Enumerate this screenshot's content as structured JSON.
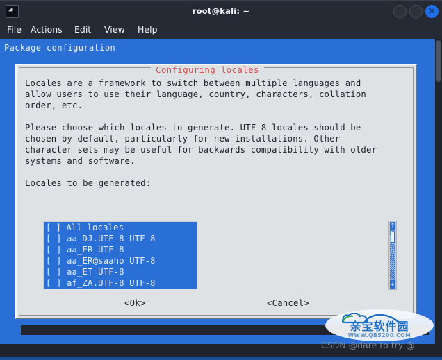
{
  "window": {
    "title": "root@kali: ~",
    "icon": "terminal-icon",
    "icon_glyph": "◢",
    "controls": {
      "minimize_label": "",
      "maximize_label": "",
      "close_label": "✕"
    }
  },
  "menubar": {
    "items": [
      {
        "label": "File"
      },
      {
        "label": "Actions"
      },
      {
        "label": "Edit"
      },
      {
        "label": "View"
      },
      {
        "label": "Help"
      }
    ]
  },
  "terminal": {
    "header": "Package configuration",
    "background_color": "#2a6fd6"
  },
  "dialog": {
    "title": "Configuring locales",
    "title_color": "#d94f4f",
    "background_color": "#dfe2e4",
    "paragraphs": [
      "Locales are a framework to switch between multiple languages and\nallow users to use their language, country, characters, collation\norder, etc.",
      "Please choose which locales to generate. UTF-8 locales should be\nchosen by default, particularly for new installations. Other\ncharacter sets may be useful for backwards compatibility with older\nsystems and software.",
      "Locales to be generated:"
    ],
    "list": {
      "items": [
        {
          "checkbox_open": "[",
          "checkbox_close": "]",
          "checked": false,
          "cursor": true,
          "label": "All locales"
        },
        {
          "checkbox_open": "[",
          "checkbox_close": "]",
          "checked": false,
          "cursor": false,
          "label": "aa_DJ.UTF-8 UTF-8"
        },
        {
          "checkbox_open": "[",
          "checkbox_close": "]",
          "checked": false,
          "cursor": false,
          "label": "aa_ER UTF-8"
        },
        {
          "checkbox_open": "[",
          "checkbox_close": "]",
          "checked": false,
          "cursor": false,
          "label": "aa_ER@saaho UTF-8"
        },
        {
          "checkbox_open": "[",
          "checkbox_close": "]",
          "checked": false,
          "cursor": false,
          "label": "aa_ET UTF-8"
        },
        {
          "checkbox_open": "[",
          "checkbox_close": "]",
          "checked": false,
          "cursor": false,
          "label": "af_ZA.UTF-8 UTF-8"
        }
      ],
      "selection_color": "#2a6fd6",
      "cursor_color": "#d01f1f"
    },
    "scrollbar": {
      "up_arrow": "↑",
      "down_arrow": "↓"
    },
    "buttons": {
      "ok": "<Ok>",
      "cancel": "<Cancel>"
    }
  },
  "watermark": {
    "brand": "亲宝软件园",
    "url": "WWW.QB5200.COM",
    "credit": "CSDN @dare to try @"
  }
}
